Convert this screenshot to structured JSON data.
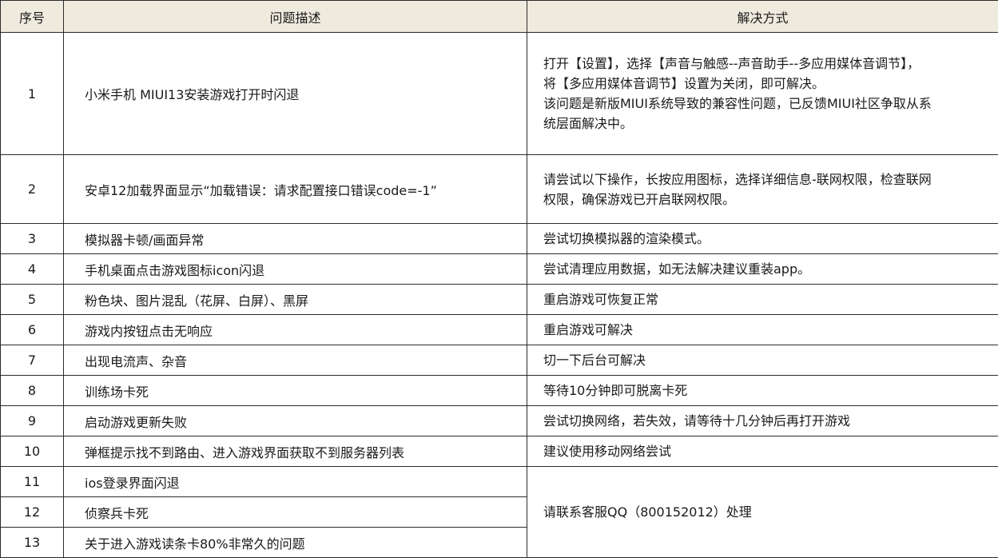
{
  "headers": {
    "num": "序号",
    "problem": "问题描述",
    "solution": "解决方式"
  },
  "rows": [
    {
      "num": "1",
      "problem": "小米手机 MIUI13安装游戏打开时闪退",
      "solution": [
        "打开【设置】，选择【声音与触感--声音助手--多应用媒体音调节】，",
        "将【多应用媒体音调节】设置为关闭，即可解决。",
        "该问题是新版MIUI系统导致的兼容性问题，已反馈MIUI社区争取从系",
        "统层面解决中。"
      ]
    },
    {
      "num": "2",
      "problem": "安卓12加载界面显示“加载错误：请求配置接口错误code=-1”",
      "solution": [
        "请尝试以下操作，长按应用图标，选择详细信息-联网权限，检查联网",
        "权限，确保游戏已开启联网权限。"
      ]
    },
    {
      "num": "3",
      "problem": "模拟器卡顿/画面异常",
      "solution": [
        "尝试切换模拟器的渲染模式。"
      ]
    },
    {
      "num": "4",
      "problem": "手机桌面点击游戏图标icon闪退",
      "solution": [
        "尝试清理应用数据，如无法解决建议重装app。"
      ]
    },
    {
      "num": "5",
      "problem": "粉色块、图片混乱（花屏、白屏）、黑屏",
      "solution": [
        "重启游戏可恢复正常"
      ]
    },
    {
      "num": "6",
      "problem": "游戏内按钮点击无响应",
      "solution": [
        "重启游戏可解决"
      ]
    },
    {
      "num": "7",
      "problem": "出现电流声、杂音",
      "solution": [
        "切一下后台可解决"
      ]
    },
    {
      "num": "8",
      "problem": "训练场卡死",
      "solution": [
        "等待10分钟即可脱离卡死"
      ]
    },
    {
      "num": "9",
      "problem": "启动游戏更新失败",
      "solution": [
        "尝试切换网络，若失效，请等待十几分钟后再打开游戏"
      ]
    },
    {
      "num": "10",
      "problem": "弹框提示找不到路由、进入游戏界面获取不到服务器列表",
      "solution": [
        "建议使用移动网络尝试"
      ]
    },
    {
      "num": "11",
      "problem": "ios登录界面闪退",
      "solution": [
        "请联系客服QQ（800152012）处理"
      ]
    },
    {
      "num": "12",
      "problem": "侦察兵卡死",
      "solution": []
    },
    {
      "num": "13",
      "problem": "关于进入游戏读条卡80%非常久的问题",
      "solution": []
    }
  ]
}
